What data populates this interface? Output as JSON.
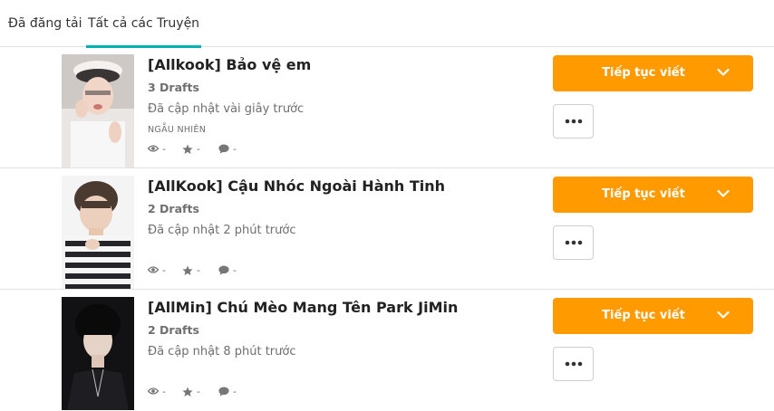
{
  "tabs": [
    {
      "label": "Đã đăng tải",
      "active": false
    },
    {
      "label": "Tất cả các Truyện",
      "active": true
    }
  ],
  "colors": {
    "accent": "#00b2b2",
    "button": "#ff9a00",
    "muted_text": "#6f6f6f"
  },
  "stories": [
    {
      "title": "[Allkook] Bảo vệ em",
      "drafts": "3 Drafts",
      "updated": "Đã cập nhật vài giây trước",
      "tagline": "NGẪU NHIÊN",
      "stats": {
        "reads": "-",
        "votes": "-",
        "comments": "-"
      },
      "continue_label": "Tiếp tục viết"
    },
    {
      "title": "[AllKook] Cậu Nhóc Ngoài Hành Tinh",
      "drafts": "2 Drafts",
      "updated": "Đã cập nhật 2 phút trước",
      "tagline": "",
      "stats": {
        "reads": "-",
        "votes": "-",
        "comments": "-"
      },
      "continue_label": "Tiếp tục viết"
    },
    {
      "title": "[AllMin] Chú Mèo Mang Tên Park JiMin",
      "drafts": "2 Drafts",
      "updated": "Đã cập nhật 8 phút trước",
      "tagline": "",
      "stats": {
        "reads": "-",
        "votes": "-",
        "comments": "-"
      },
      "continue_label": "Tiếp tục viết"
    }
  ],
  "icons": [
    "eye-icon",
    "star-icon",
    "comment-icon",
    "chevron-down-icon",
    "more-icon"
  ]
}
